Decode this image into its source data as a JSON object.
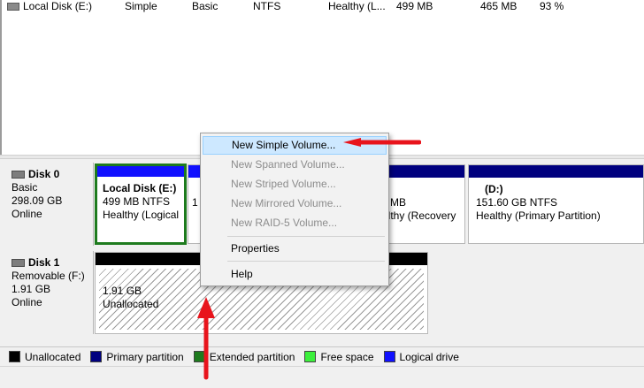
{
  "volume_row": {
    "name": "Local Disk (E:)",
    "layout": "Simple",
    "type": "Basic",
    "file_system": "NTFS",
    "status": "Healthy (L...",
    "capacity": "499 MB",
    "free_space": "465 MB",
    "percent_free": "93 %"
  },
  "disks": [
    {
      "title": "Disk 0",
      "type": "Basic",
      "size": "298.09 GB",
      "state": "Online",
      "partitions": [
        {
          "name": "Local Disk  (E:)",
          "line2": "499 MB NTFS",
          "line3": "Healthy (Logical"
        },
        {
          "line1": "1"
        },
        {
          "line2": "MB",
          "line3": "althy (Recovery"
        },
        {
          "name": "(D:)",
          "line2": "151.60 GB NTFS",
          "line3": "Healthy (Primary Partition)"
        }
      ]
    },
    {
      "title": "Disk 1",
      "type": "Removable (F:)",
      "size": "1.91 GB",
      "state": "Online",
      "partitions": [
        {
          "line1": "1.91 GB",
          "line2": "Unallocated"
        }
      ]
    }
  ],
  "legend": [
    {
      "label": "Unallocated",
      "color": "#000000"
    },
    {
      "label": "Primary partition",
      "color": "#00007f"
    },
    {
      "label": "Extended partition",
      "color": "#1e7b1e"
    },
    {
      "label": "Free space",
      "color": "#3cf03c"
    },
    {
      "label": "Logical drive",
      "color": "#1010ff"
    }
  ],
  "context_menu": {
    "items": [
      {
        "label": "New Simple Volume...",
        "enabled": true,
        "hover": true
      },
      {
        "label": "New Spanned Volume...",
        "enabled": false
      },
      {
        "label": "New Striped Volume...",
        "enabled": false
      },
      {
        "label": "New Mirrored Volume...",
        "enabled": false
      },
      {
        "label": "New RAID-5 Volume...",
        "enabled": false
      },
      {
        "label": "Properties",
        "enabled": true
      },
      {
        "label": "Help",
        "enabled": true
      }
    ]
  },
  "colors": {
    "primary_bar": "#00007f",
    "logical_bar": "#1010ff",
    "unallocated_bar": "#000000",
    "selected_border": "#1e7b1e",
    "menu_hover": "#cde8ff",
    "arrow": "#e8141c"
  },
  "icons": [
    "disk-icon",
    "red-arrow-annotation"
  ]
}
